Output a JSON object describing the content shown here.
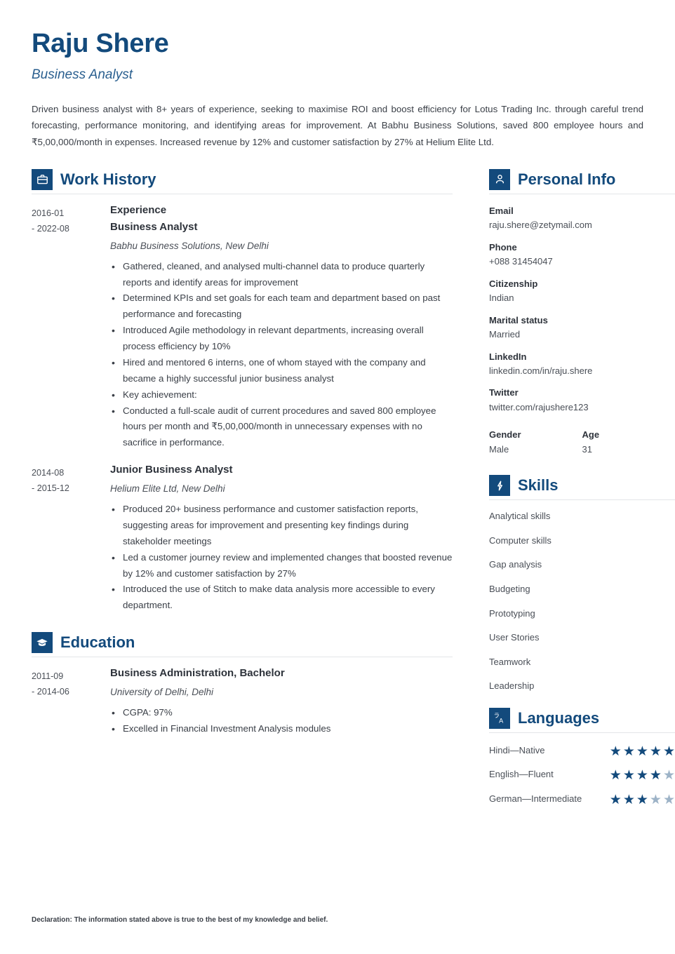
{
  "header": {
    "name": "Raju Shere",
    "job_title": "Business Analyst",
    "summary": "Driven business analyst with 8+ years of experience, seeking to maximise ROI and boost efficiency for Lotus Trading Inc. through careful trend forecasting, performance monitoring, and identifying areas for improvement. At Babhu Business Solutions, saved 800 employee hours and ₹5,00,000/month in expenses. Increased revenue by 12% and customer satisfaction by 27% at Helium Elite Ltd."
  },
  "theme": {
    "accent": "#134a7c",
    "text": "#3a3f47",
    "star_empty": "#9db3c7",
    "rule": "#e3e5e8"
  },
  "work_history": {
    "icon": "briefcase-icon",
    "title": "Work History",
    "entries": [
      {
        "date_start": "2016-01",
        "date_end": "- 2022-08",
        "pretitle": "Experience",
        "title": "Business Analyst",
        "subtitle": "Babhu Business Solutions, New Delhi",
        "bullets": [
          "Gathered, cleaned, and analysed multi-channel data to produce quarterly reports and identify areas for improvement",
          "Determined KPIs and set goals for each team and department based on past performance and forecasting",
          "Introduced Agile methodology in relevant departments, increasing overall process efficiency by 10%",
          "Hired and mentored 6 interns, one of whom stayed with the company and became a highly successful junior business analyst",
          "Key achievement:",
          "Conducted a full-scale audit of current procedures and saved 800 employee hours per month and ₹5,00,000/month in unnecessary expenses with no sacrifice in performance."
        ]
      },
      {
        "date_start": "2014-08",
        "date_end": "- 2015-12",
        "pretitle": "",
        "title": "Junior Business Analyst",
        "subtitle": "Helium Elite Ltd, New Delhi",
        "bullets": [
          "Produced 20+ business performance and customer satisfaction reports, suggesting areas for improvement and presenting key findings during stakeholder meetings",
          "Led a customer journey review and implemented changes that boosted revenue by 12% and customer satisfaction by 27%",
          "Introduced the use of Stitch to make data analysis more accessible to every department."
        ]
      }
    ]
  },
  "education": {
    "icon": "graduation-cap-icon",
    "title": "Education",
    "entries": [
      {
        "date_start": "2011-09",
        "date_end": "- 2014-06",
        "title": "Business Administration, Bachelor",
        "subtitle": "University of Delhi, Delhi",
        "bullets": [
          "CGPA: 97%",
          "Excelled in Financial Investment Analysis modules"
        ]
      }
    ]
  },
  "personal_info": {
    "icon": "person-icon",
    "title": "Personal Info",
    "items": [
      {
        "label": "Email",
        "value": "raju.shere@zetymail.com"
      },
      {
        "label": "Phone",
        "value": "+088 31454047"
      },
      {
        "label": "Citizenship",
        "value": "Indian"
      },
      {
        "label": "Marital status",
        "value": "Married"
      },
      {
        "label": "LinkedIn",
        "value": "linkedin.com/in/raju.shere"
      },
      {
        "label": "Twitter",
        "value": "twitter.com/rajushere123"
      }
    ],
    "pair": [
      {
        "label": "Gender",
        "value": "Male"
      },
      {
        "label": "Age",
        "value": "31"
      }
    ]
  },
  "skills": {
    "icon": "lightbulb-icon",
    "title": "Skills",
    "items": [
      "Analytical skills",
      "Computer skills",
      "Gap analysis",
      "Budgeting",
      "Prototyping",
      "User Stories",
      "Teamwork",
      "Leadership"
    ]
  },
  "languages": {
    "icon": "translate-icon",
    "title": "Languages",
    "max_stars": 5,
    "items": [
      {
        "name": "Hindi—Native",
        "rating": 5
      },
      {
        "name": "English—Fluent",
        "rating": 4
      },
      {
        "name": "German—Intermediate",
        "rating": 3
      }
    ]
  },
  "footer": {
    "declaration": "Declaration: The information stated above is true to the best of my knowledge and belief."
  }
}
